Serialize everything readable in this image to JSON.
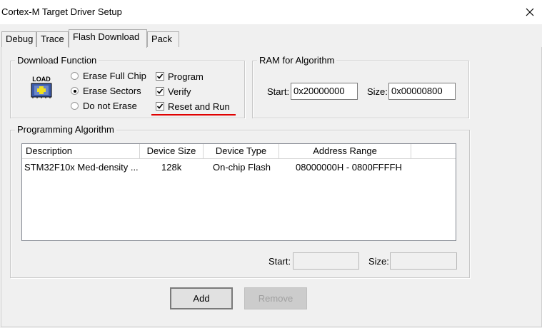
{
  "window": {
    "title": "Cortex-M Target Driver Setup"
  },
  "tabs": [
    {
      "label": "Debug"
    },
    {
      "label": "Trace"
    },
    {
      "label": "Flash Download"
    },
    {
      "label": "Pack"
    }
  ],
  "download_function": {
    "label": "Download Function",
    "icon_text": "LOAD",
    "erase_options": [
      {
        "label": "Erase Full Chip",
        "checked": false
      },
      {
        "label": "Erase Sectors",
        "checked": true
      },
      {
        "label": "Do not Erase",
        "checked": false
      }
    ],
    "checkboxes": [
      {
        "label": "Program",
        "checked": true
      },
      {
        "label": "Verify",
        "checked": true
      },
      {
        "label": "Reset and Run",
        "checked": true
      }
    ]
  },
  "ram_for_algorithm": {
    "label": "RAM for Algorithm",
    "start_label": "Start:",
    "start_value": "0x20000000",
    "size_label": "Size:",
    "size_value": "0x00000800"
  },
  "programming_algorithm": {
    "label": "Programming Algorithm",
    "columns": [
      "Description",
      "Device Size",
      "Device Type",
      "Address Range"
    ],
    "rows": [
      [
        "STM32F10x Med-density ...",
        "128k",
        "On-chip Flash",
        "08000000H - 0800FFFFH"
      ]
    ],
    "start_label": "Start:",
    "start_value": "",
    "size_label": "Size:",
    "size_value": ""
  },
  "buttons": {
    "add": "Add",
    "remove": "Remove"
  },
  "colors": {
    "annotation_red": "#e00000"
  }
}
